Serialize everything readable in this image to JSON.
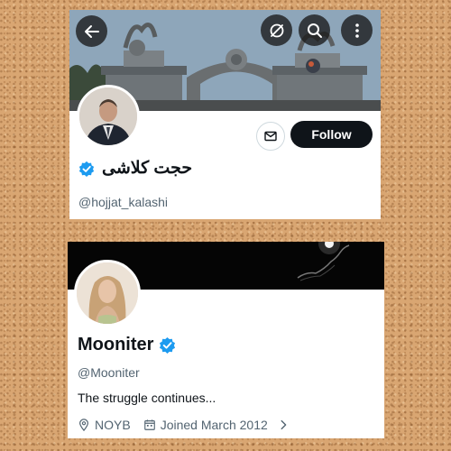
{
  "profile_1": {
    "display_name": "حجت کلاشی",
    "handle": "@hojjat_kalashi",
    "follow_label": "Follow",
    "verified": true,
    "icons": [
      "back-arrow-icon",
      "refresh-off-icon",
      "search-icon",
      "more-vertical-icon",
      "mail-icon",
      "verified-badge-icon"
    ]
  },
  "profile_2": {
    "display_name": "Mooniter",
    "handle": "@Mooniter",
    "bio": "The struggle continues...",
    "location": "NOYB",
    "joined": "Joined March 2012",
    "verified": true,
    "icons": [
      "location-pin-icon",
      "calendar-icon",
      "chevron-right-icon",
      "verified-badge-icon"
    ]
  },
  "colors": {
    "follow_button": "#0f1419",
    "verified_blue": "#1d9bf0",
    "secondary_text": "#536471"
  }
}
